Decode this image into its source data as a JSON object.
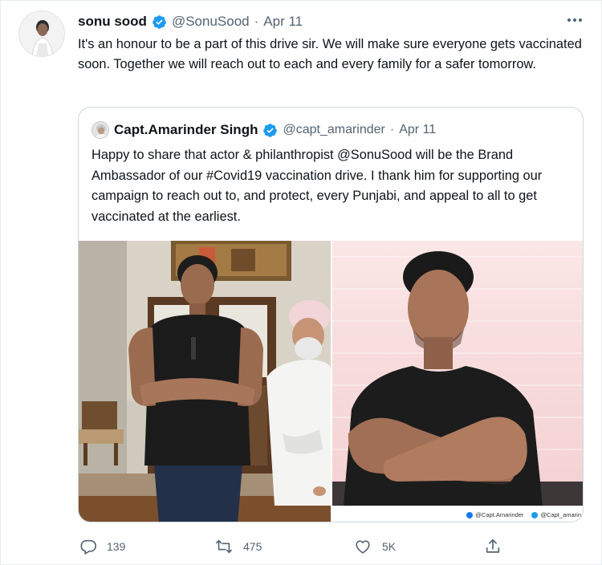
{
  "tweet": {
    "author_name": "sonu sood",
    "author_handle": "@SonuSood",
    "separator": "·",
    "date": "Apr 11",
    "text": "It's an honour to be a part of this drive sir. We will make sure everyone gets vaccinated soon. Together we will reach out to each and every family for a safer tomorrow.",
    "more_icon": "more-dots-icon",
    "verified_color": "#1d9bf0"
  },
  "quoted": {
    "author_name": "Capt.Amarinder Singh",
    "author_handle": "@capt_amarinder",
    "separator": "·",
    "date": "Apr 11",
    "text": "Happy to share that actor & philanthropist @SonuSood will be the Brand Ambassador of our #Covid19 vaccination drive. I thank him for supporting our campaign to reach out to, and protect, every Punjabi, and appeal to all to get vaccinated at the earliest.",
    "credits": [
      "@Capt.Amarinder",
      "@Capt_amarin"
    ]
  },
  "actions": {
    "reply_count": "139",
    "retweet_count": "475",
    "like_count": "5K",
    "icons": [
      "reply-icon",
      "retweet-icon",
      "like-icon",
      "share-icon"
    ]
  },
  "colors": {
    "text": "#0f1419",
    "secondary": "#536471",
    "border": "#cfd9de",
    "accent": "#1d9bf0"
  }
}
